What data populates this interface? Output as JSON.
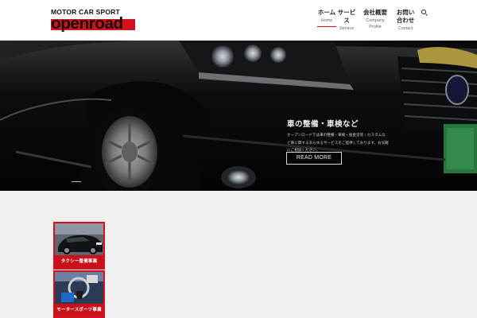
{
  "brand": {
    "top_line": "MOTOR CAR SPORT",
    "name": "openroad"
  },
  "nav": {
    "items": [
      {
        "jp": "ホーム",
        "en": "Home",
        "active": true
      },
      {
        "jp": "サービス",
        "en": "Service",
        "active": false
      },
      {
        "jp": "会社概要",
        "en": "Company Profile",
        "active": false
      },
      {
        "jp": "お問い合わせ",
        "en": "Contact",
        "active": false
      }
    ],
    "search_icon": "search-icon"
  },
  "hero": {
    "title": "車の整備・車検など",
    "description": "オープンロードでは車の整備・車検・板金塗装・カスタムなど車に関するあらゆるサービスをご提供しております。お気軽にご相談ください。",
    "button_label": "READ MORE"
  },
  "cards": [
    {
      "label": "タクシー整備事業"
    },
    {
      "label": "モータースポーツ事業"
    }
  ],
  "colors": {
    "accent": "#d3121c",
    "background": "#f0f0f0",
    "header": "#ffffff"
  }
}
